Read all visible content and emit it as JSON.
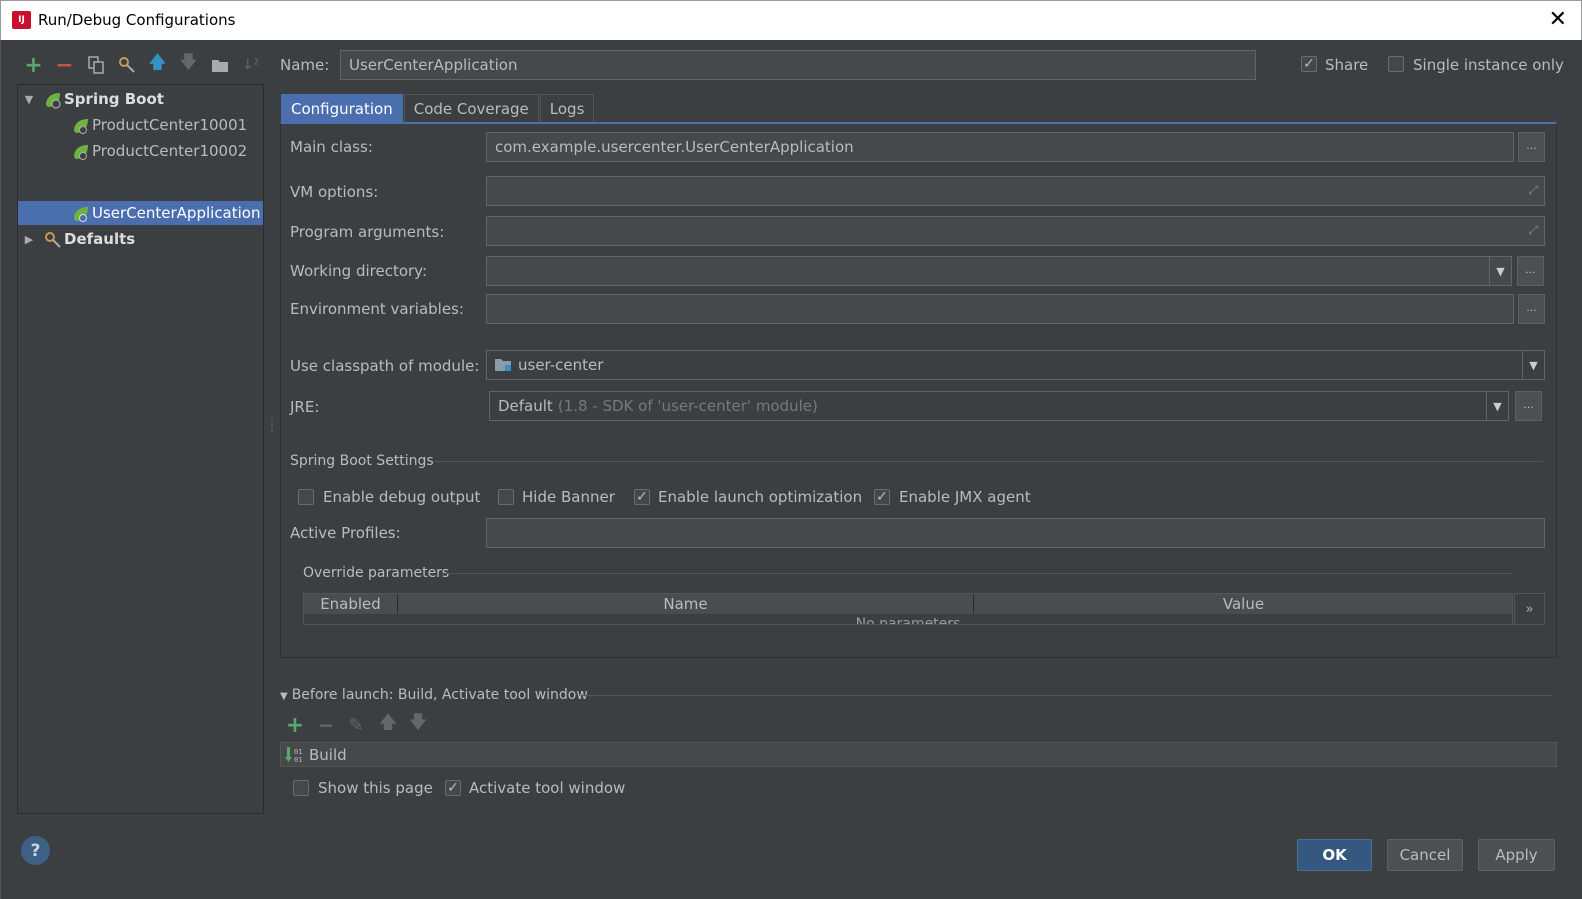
{
  "window": {
    "title": "Run/Debug Configurations",
    "app_icon": "IJ",
    "close": "✕"
  },
  "tree": {
    "groups": [
      {
        "label": "Spring Boot",
        "expanded": true
      },
      {
        "label": "Defaults",
        "expanded": false
      }
    ],
    "items": [
      {
        "label": "ProductCenter10001"
      },
      {
        "label": "ProductCenter10002"
      },
      {
        "label": "UserCenterApplication",
        "selected": true
      }
    ]
  },
  "header": {
    "name_label": "Name:",
    "name_value": "UserCenterApplication",
    "share_label": "Share",
    "share_checked": true,
    "single_instance_label": "Single instance only",
    "single_instance_checked": false
  },
  "tabs": [
    "Configuration",
    "Code Coverage",
    "Logs"
  ],
  "form": {
    "main_class_label": "Main class:",
    "main_class_value": "com.example.usercenter.UserCenterApplication",
    "vm_options_label": "VM options:",
    "program_args_label": "Program arguments:",
    "working_dir_label": "Working directory:",
    "env_vars_label": "Environment variables:",
    "classpath_label": "Use classpath of module:",
    "classpath_value": "user-center",
    "jre_label": "JRE:",
    "jre_value": "Default",
    "jre_hint": "(1.8 - SDK of 'user-center' module)",
    "dots": "...",
    "dropdown_arrow": "▼"
  },
  "spring_boot": {
    "section_title": "Spring Boot Settings",
    "debug_output_label": "Enable debug output",
    "hide_banner_label": "Hide Banner",
    "launch_opt_label": "Enable launch optimization",
    "jmx_label": "Enable JMX agent",
    "active_profiles_label": "Active Profiles:"
  },
  "override": {
    "section_title": "Override parameters",
    "columns": [
      "Enabled",
      "Name",
      "Value"
    ],
    "empty_text": "No parameters",
    "more": "»"
  },
  "before_launch": {
    "title": "Before launch: Build, Activate tool window",
    "build_label": "Build",
    "show_page_label": "Show this page",
    "activate_label": "Activate tool window"
  },
  "buttons": {
    "ok": "OK",
    "cancel": "Cancel",
    "apply": "Apply",
    "help": "?"
  },
  "colors": {
    "background": "#3c3f41",
    "selection": "#4b6eaf",
    "add_green": "#59a869",
    "remove_red": "#c75450",
    "up_blue": "#3592c4"
  }
}
